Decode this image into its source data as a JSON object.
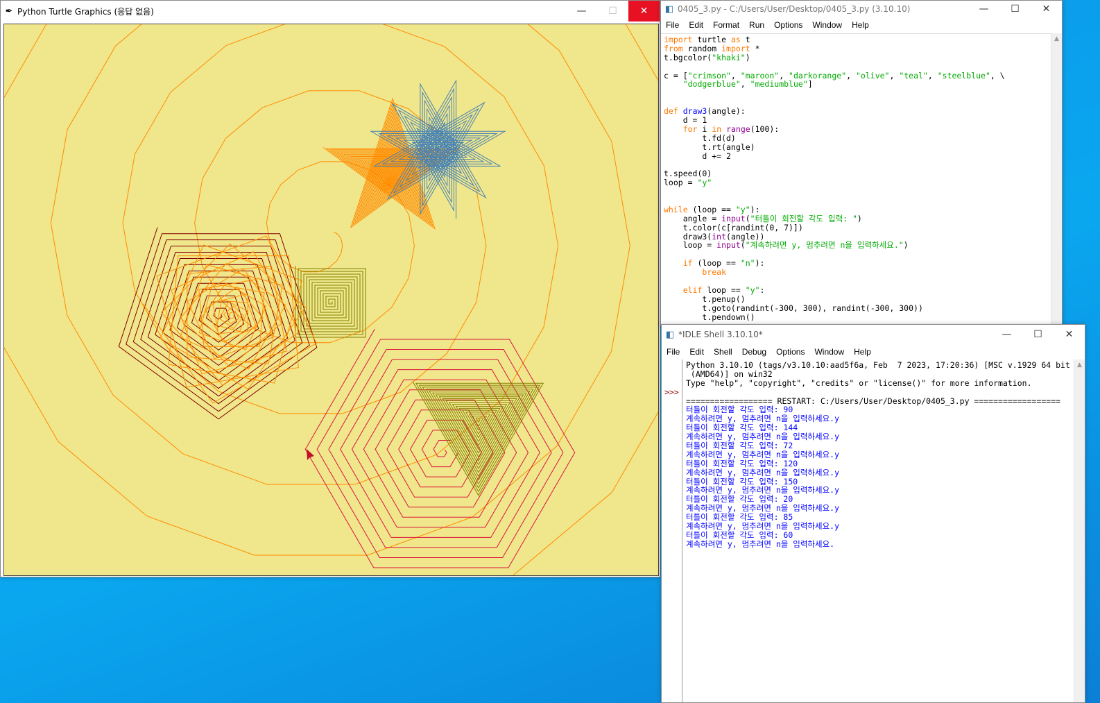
{
  "turtle_window": {
    "icon": "feather-icon",
    "title": "Python Turtle Graphics (응답 없음)",
    "canvas_bg": "#f0e68c"
  },
  "editor_window": {
    "title": "0405_3.py - C:/Users/User/Desktop/0405_3.py (3.10.10)",
    "menu": [
      "File",
      "Edit",
      "Format",
      "Run",
      "Options",
      "Window",
      "Help"
    ],
    "code": [
      [
        [
          "kw",
          "import"
        ],
        [
          "p",
          " turtle "
        ],
        [
          "kw",
          "as"
        ],
        [
          "p",
          " t"
        ]
      ],
      [
        [
          "kw",
          "from"
        ],
        [
          "p",
          " random "
        ],
        [
          "kw",
          "import"
        ],
        [
          "p",
          " *"
        ]
      ],
      [
        [
          "p",
          "t.bgcolor("
        ],
        [
          "st",
          "\"khaki\""
        ],
        [
          "p",
          ")"
        ]
      ],
      [],
      [
        [
          "p",
          "c = ["
        ],
        [
          "st",
          "\"crimson\""
        ],
        [
          "p",
          ", "
        ],
        [
          "st",
          "\"maroon\""
        ],
        [
          "p",
          ", "
        ],
        [
          "st",
          "\"darkorange\""
        ],
        [
          "p",
          ", "
        ],
        [
          "st",
          "\"olive\""
        ],
        [
          "p",
          ", "
        ],
        [
          "st",
          "\"teal\""
        ],
        [
          "p",
          ", "
        ],
        [
          "st",
          "\"steelblue\""
        ],
        [
          "p",
          ", \\"
        ]
      ],
      [
        [
          "p",
          "    "
        ],
        [
          "st",
          "\"dodgerblue\""
        ],
        [
          "p",
          ", "
        ],
        [
          "st",
          "\"mediumblue\""
        ],
        [
          "p",
          "]"
        ]
      ],
      [],
      [],
      [
        [
          "kw",
          "def"
        ],
        [
          "p",
          " "
        ],
        [
          "df",
          "draw3"
        ],
        [
          "p",
          "(angle):"
        ]
      ],
      [
        [
          "p",
          "    d = 1"
        ]
      ],
      [
        [
          "p",
          "    "
        ],
        [
          "kw",
          "for"
        ],
        [
          "p",
          " i "
        ],
        [
          "kw",
          "in"
        ],
        [
          "p",
          " "
        ],
        [
          "bi",
          "range"
        ],
        [
          "p",
          "(100):"
        ]
      ],
      [
        [
          "p",
          "        t.fd(d)"
        ]
      ],
      [
        [
          "p",
          "        t.rt(angle)"
        ]
      ],
      [
        [
          "p",
          "        d += 2"
        ]
      ],
      [],
      [
        [
          "p",
          "t.speed(0)"
        ]
      ],
      [
        [
          "p",
          "loop = "
        ],
        [
          "st",
          "\"y\""
        ]
      ],
      [],
      [],
      [
        [
          "kw",
          "while"
        ],
        [
          "p",
          " (loop == "
        ],
        [
          "st",
          "\"y\""
        ],
        [
          "p",
          "):"
        ]
      ],
      [
        [
          "p",
          "    angle = "
        ],
        [
          "bi",
          "input"
        ],
        [
          "p",
          "("
        ],
        [
          "st",
          "\"터틀이 회전할 각도 입력: \""
        ],
        [
          "p",
          ")"
        ]
      ],
      [
        [
          "p",
          "    t.color(c[randint(0, 7)])"
        ]
      ],
      [
        [
          "p",
          "    draw3("
        ],
        [
          "bi",
          "int"
        ],
        [
          "p",
          "(angle))"
        ]
      ],
      [
        [
          "p",
          "    loop = "
        ],
        [
          "bi",
          "input"
        ],
        [
          "p",
          "("
        ],
        [
          "st",
          "\"계속하려면 y, 멈추려면 n을 입력하세요.\""
        ],
        [
          "p",
          ")"
        ]
      ],
      [],
      [
        [
          "p",
          "    "
        ],
        [
          "kw",
          "if"
        ],
        [
          "p",
          " (loop == "
        ],
        [
          "st",
          "\"n\""
        ],
        [
          "p",
          "):"
        ]
      ],
      [
        [
          "p",
          "        "
        ],
        [
          "kw",
          "break"
        ]
      ],
      [],
      [
        [
          "p",
          "    "
        ],
        [
          "kw",
          "elif"
        ],
        [
          "p",
          " loop == "
        ],
        [
          "st",
          "\"y\""
        ],
        [
          "p",
          ":"
        ]
      ],
      [
        [
          "p",
          "        t.penup()"
        ]
      ],
      [
        [
          "p",
          "        t.goto(randint(-300, 300), randint(-300, 300))"
        ]
      ],
      [
        [
          "p",
          "        t.pendown()"
        ]
      ]
    ]
  },
  "shell_window": {
    "title": "*IDLE Shell 3.10.10*",
    "menu": [
      "File",
      "Edit",
      "Shell",
      "Debug",
      "Options",
      "Window",
      "Help"
    ],
    "prompt": ">>>",
    "header": [
      "Python 3.10.10 (tags/v3.10.10:aad5f6a, Feb  7 2023, 17:20:36) [MSC v.1929 64 bit",
      " (AMD64)] on win32",
      "Type \"help\", \"copyright\", \"credits\" or \"license()\" for more information.",
      "",
      "================== RESTART: C:/Users/User/Desktop/0405_3.py =================="
    ],
    "output": [
      "터틀이 회전할 각도 입력: 90",
      "계속하려면 y, 멈추려면 n을 입력하세요.y",
      "터틀이 회전할 각도 입력: 144",
      "계속하려면 y, 멈추려면 n을 입력하세요.y",
      "터틀이 회전할 각도 입력: 72",
      "계속하려면 y, 멈추려면 n을 입력하세요.y",
      "터틀이 회전할 각도 입력: 120",
      "계속하려면 y, 멈추려면 n을 입력하세요.y",
      "터틀이 회전할 각도 입력: 150",
      "계속하려면 y, 멈추려면 n을 입력하세요.y",
      "터틀이 회전할 각도 입력: 20",
      "계속하려면 y, 멈추려면 n을 입력하세요.y",
      "터틀이 회전할 각도 입력: 85",
      "계속하려면 y, 멈추려면 n을 입력하세요.y",
      "터틀이 회전할 각도 입력: 60",
      "계속하려면 y, 멈추려면 n을 입력하세요."
    ]
  },
  "window_controls": {
    "minimize": "—",
    "maximize": "☐",
    "close": "✕"
  }
}
